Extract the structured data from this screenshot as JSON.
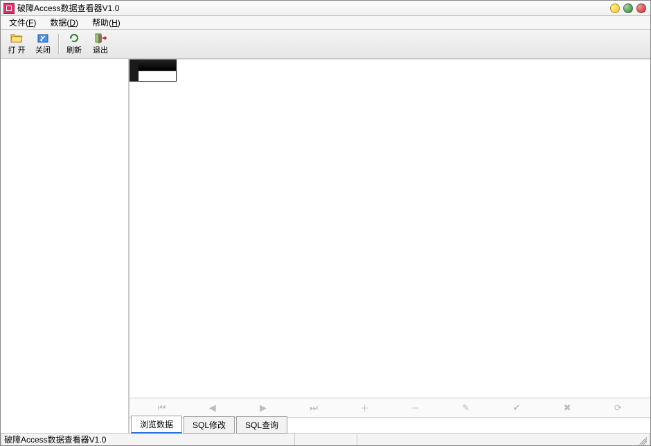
{
  "titlebar": {
    "title": "破障Access数据查看器V1.0"
  },
  "menubar": {
    "items": [
      {
        "label": "文件",
        "key": "F"
      },
      {
        "label": "数据",
        "key": "D"
      },
      {
        "label": "帮助",
        "key": "H"
      }
    ]
  },
  "toolbar": {
    "open": "打 开",
    "close": "关闭",
    "refresh": "刷新",
    "exit": "退出"
  },
  "navigator": {
    "first": "⏮",
    "prev": "◀",
    "next": "▶",
    "last": "⏭",
    "add": "＋",
    "delete": "－",
    "edit": "✎",
    "post": "✔",
    "cancel": "✖",
    "refresh": "⟳"
  },
  "tabs": {
    "browse": "浏览数据",
    "sqlmod": "SQL修改",
    "sqlquery": "SQL查询"
  },
  "statusbar": {
    "text": "破障Access数据查看器V1.0"
  }
}
